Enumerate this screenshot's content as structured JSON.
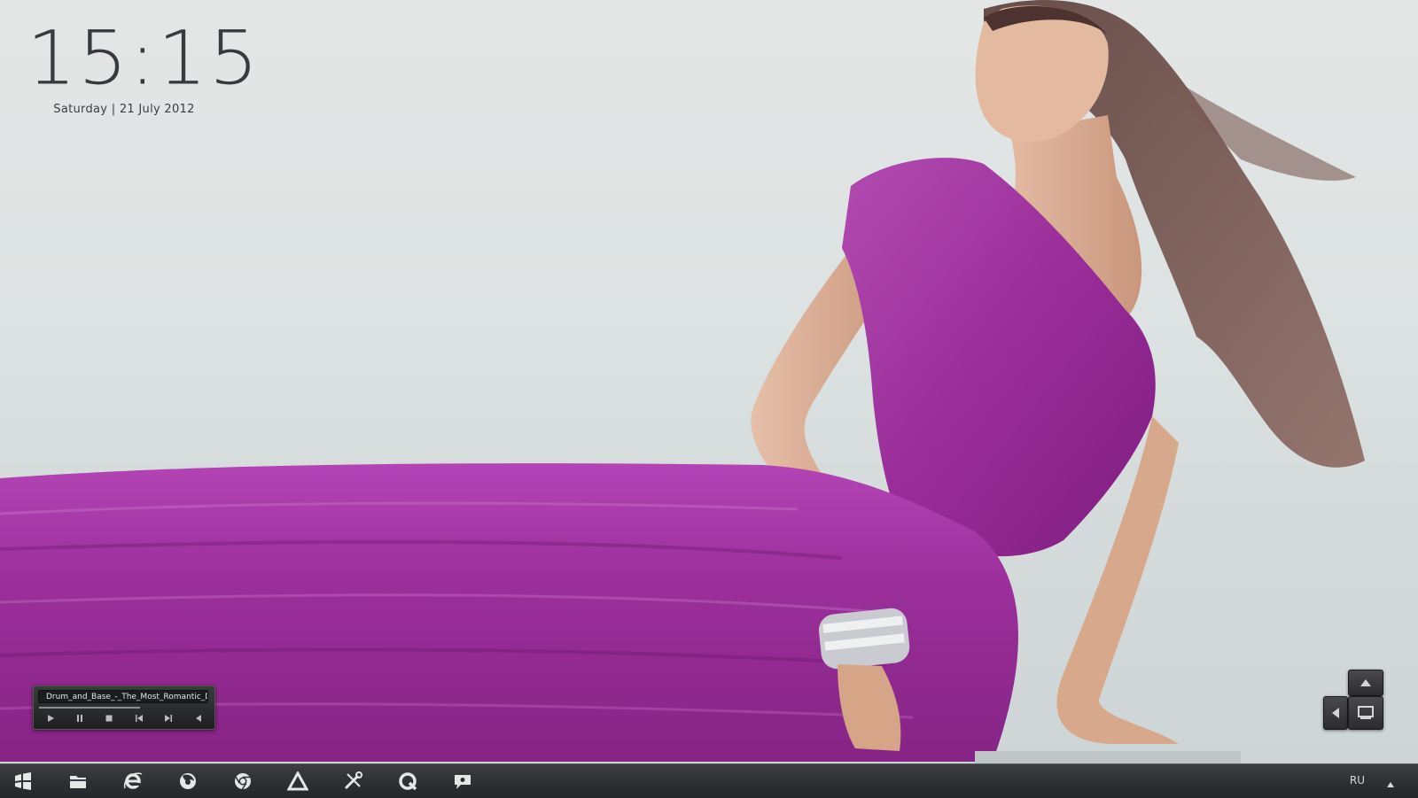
{
  "clock": {
    "time": "15:15",
    "date": "Saturday | 21 July 2012"
  },
  "player": {
    "track": "Drum_and_Base_-_The_Most_Romantic_Drum",
    "progress": 0.6,
    "controls": [
      "play-icon",
      "pause-icon",
      "stop-icon",
      "previous-icon",
      "next-icon",
      "volume-icon"
    ]
  },
  "taskbar": {
    "icons": [
      "windows-start-icon",
      "folder-icon",
      "internet-explorer-icon",
      "firefox-icon",
      "chrome-icon",
      "triangle-app-icon",
      "tools-icon",
      "qip-icon",
      "messenger-icon"
    ],
    "tray_language": "RU"
  },
  "colors": {
    "dress": "#a0309f",
    "sky": "#e0e4e3",
    "taskbar": "#2e2f32",
    "clock_text": "#3a3a3e"
  }
}
